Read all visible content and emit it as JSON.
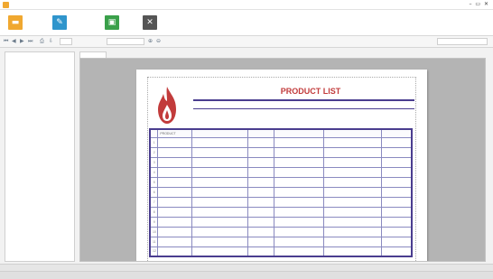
{
  "colors": {
    "ribbon_btn_1": "#f0a830",
    "ribbon_btn_2": "#2f95cc",
    "ribbon_btn_3": "#3aa04a",
    "ribbon_btn_4": "#555555",
    "report_title": "#c23b3b",
    "report_border": "#4a3d8f"
  },
  "window": {
    "controls": "– ▭ ✕"
  },
  "ribbon": {
    "buttons": [
      {
        "icon": "folder-icon",
        "glyph": "▬"
      },
      {
        "icon": "design-icon",
        "glyph": "✎"
      },
      {
        "icon": "save-icon",
        "glyph": "▣"
      },
      {
        "icon": "tools-icon",
        "glyph": "✕"
      }
    ]
  },
  "report": {
    "title": "PRODUCT LIST",
    "columns": [
      "",
      "PRODUCT",
      "",
      "",
      "",
      "",
      ""
    ],
    "rows": [
      {
        "n": "1"
      },
      {
        "n": "2"
      },
      {
        "n": "3"
      },
      {
        "n": "4"
      },
      {
        "n": "5"
      },
      {
        "n": "6"
      },
      {
        "n": "7"
      },
      {
        "n": "8"
      },
      {
        "n": "9"
      },
      {
        "n": "10"
      },
      {
        "n": "11"
      },
      {
        "n": "12"
      }
    ]
  }
}
